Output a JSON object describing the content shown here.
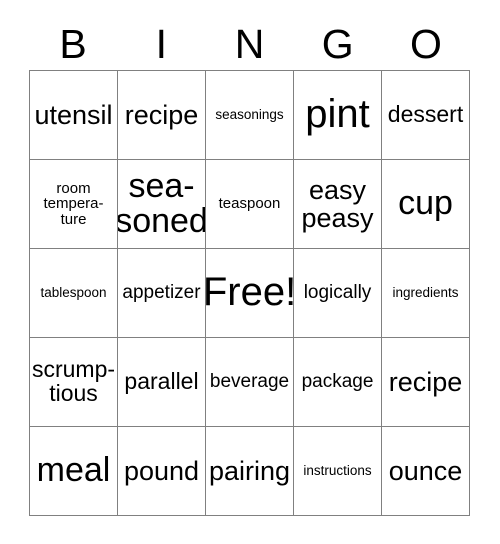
{
  "card": {
    "header": {
      "letters": [
        "B",
        "I",
        "N",
        "G",
        "O"
      ]
    },
    "grid": {
      "columns": 5,
      "rows": 5,
      "border_color": "#808080",
      "background_color": "#ffffff",
      "text_color": "#000000",
      "cells": [
        {
          "text": "utensil",
          "size": "lg",
          "row": 1,
          "col": 1
        },
        {
          "text": "recipe",
          "size": "lg",
          "row": 1,
          "col": 2
        },
        {
          "text": "seasonings",
          "size": "xxs",
          "row": 1,
          "col": 3
        },
        {
          "text": "pint",
          "size": "xxl",
          "row": 1,
          "col": 4
        },
        {
          "text": "dessert",
          "size": "md",
          "row": 1,
          "col": 5
        },
        {
          "text": "room\ntempera-\nture",
          "size": "xs",
          "row": 2,
          "col": 1
        },
        {
          "text": "sea-\nsoned",
          "size": "xl",
          "row": 2,
          "col": 2
        },
        {
          "text": "teaspoon",
          "size": "xs",
          "row": 2,
          "col": 3
        },
        {
          "text": "easy\npeasy",
          "size": "lg",
          "row": 2,
          "col": 4
        },
        {
          "text": "cup",
          "size": "xl",
          "row": 2,
          "col": 5
        },
        {
          "text": "tablespoon",
          "size": "xxs",
          "row": 3,
          "col": 1
        },
        {
          "text": "appetizer",
          "size": "sm",
          "row": 3,
          "col": 2
        },
        {
          "text": "Free!",
          "size": "xxl",
          "row": 3,
          "col": 3
        },
        {
          "text": "logically",
          "size": "sm",
          "row": 3,
          "col": 4
        },
        {
          "text": "ingredients",
          "size": "xxs",
          "row": 3,
          "col": 5
        },
        {
          "text": "scrump-\ntious",
          "size": "md",
          "row": 4,
          "col": 1
        },
        {
          "text": "parallel",
          "size": "md",
          "row": 4,
          "col": 2
        },
        {
          "text": "beverage",
          "size": "sm",
          "row": 4,
          "col": 3
        },
        {
          "text": "package",
          "size": "sm",
          "row": 4,
          "col": 4
        },
        {
          "text": "recipe",
          "size": "lg",
          "row": 4,
          "col": 5
        },
        {
          "text": "meal",
          "size": "xl",
          "row": 5,
          "col": 1
        },
        {
          "text": "pound",
          "size": "lg",
          "row": 5,
          "col": 2
        },
        {
          "text": "pairing",
          "size": "lg",
          "row": 5,
          "col": 3
        },
        {
          "text": "instructions",
          "size": "xxs",
          "row": 5,
          "col": 4
        },
        {
          "text": "ounce",
          "size": "lg",
          "row": 5,
          "col": 5
        }
      ]
    }
  }
}
